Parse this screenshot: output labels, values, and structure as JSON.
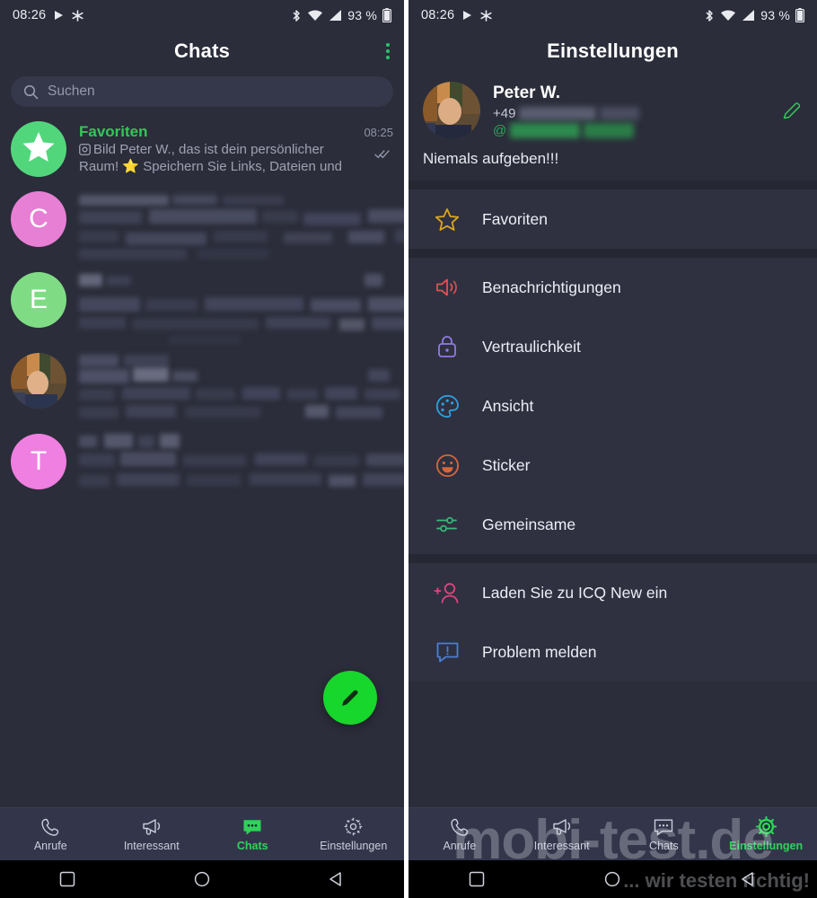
{
  "statusbar": {
    "time": "08:26",
    "battery_percent": "93 %",
    "icons": [
      "play-icon",
      "snowflake-icon",
      "bluetooth-icon",
      "wifi-icon",
      "signal-icon",
      "battery-icon"
    ]
  },
  "left": {
    "appbar": {
      "title": "Chats",
      "menu": "overflow-menu"
    },
    "search": {
      "placeholder": "Suchen",
      "value": ""
    },
    "chats": [
      {
        "name": "Favoriten",
        "time": "08:25",
        "preview_prefix": "Bild",
        "preview": "Peter W., das ist dein persönlicher Raum! ⭐ Speichern Sie Links, Dateien und",
        "avatar_letter": "★",
        "avatar_color": "#52d67c",
        "redacted": false,
        "read_state": "read"
      },
      {
        "name": "",
        "time": "",
        "preview": "",
        "avatar_letter": "C",
        "avatar_color": "#e77fd4",
        "redacted": true
      },
      {
        "name": "",
        "time": "",
        "preview": "",
        "avatar_letter": "E",
        "avatar_color": "#7fdc85",
        "redacted": true
      },
      {
        "name": "",
        "time": "",
        "preview": "",
        "avatar_letter": "",
        "avatar_color": "#4a3a2e",
        "redacted": true,
        "avatar_photo": true
      },
      {
        "name": "",
        "time": "",
        "preview": "",
        "avatar_letter": "T",
        "avatar_color": "#ef7fe0",
        "redacted": true
      }
    ],
    "fab": "compose-button",
    "tabs": [
      {
        "label": "Anrufe",
        "icon": "phone-icon",
        "active": false
      },
      {
        "label": "Interessant",
        "icon": "megaphone-icon",
        "active": false
      },
      {
        "label": "Chats",
        "icon": "chat-bubble-icon",
        "active": true
      },
      {
        "label": "Einstellungen",
        "icon": "gear-icon",
        "active": false
      }
    ]
  },
  "right": {
    "appbar": {
      "title": "Einstellungen"
    },
    "profile": {
      "name": "Peter W.",
      "phone_prefix": "+49",
      "handle_prefix": "@",
      "status": "Niemals aufgeben!!!",
      "edit": "edit-profile-button"
    },
    "groups": [
      [
        {
          "label": "Favoriten",
          "icon": "star-icon",
          "color": "#d9a520"
        }
      ],
      [
        {
          "label": "Benachrichtigungen",
          "icon": "speaker-icon",
          "color": "#e0514f"
        },
        {
          "label": "Vertraulichkeit",
          "icon": "lock-icon",
          "color": "#8f7ae8"
        },
        {
          "label": "Ansicht",
          "icon": "palette-icon",
          "color": "#2e9fe0"
        },
        {
          "label": "Sticker",
          "icon": "smiley-icon",
          "color": "#d8663a"
        },
        {
          "label": "Gemeinsame",
          "icon": "sliders-icon",
          "color": "#3bb87a"
        }
      ],
      [
        {
          "label": "Laden Sie zu ICQ New ein",
          "icon": "add-user-icon",
          "color": "#e0457f"
        },
        {
          "label": "Problem melden",
          "icon": "report-icon",
          "color": "#4a7fd4"
        }
      ]
    ],
    "tabs": [
      {
        "label": "Anrufe",
        "icon": "phone-icon",
        "active": false
      },
      {
        "label": "Interessant",
        "icon": "megaphone-icon",
        "active": false
      },
      {
        "label": "Chats",
        "icon": "chat-bubble-icon",
        "active": false
      },
      {
        "label": "Einstellungen",
        "icon": "gear-icon",
        "active": true
      }
    ]
  },
  "watermark": {
    "main": "mobi-test.de",
    "sub": "... wir testen richtig!"
  },
  "colors": {
    "background": "#2b2d3a",
    "surface": "#2f3140",
    "accent_green": "#34c759",
    "fab_green": "#17d62c",
    "tabbar": "#33364a"
  }
}
